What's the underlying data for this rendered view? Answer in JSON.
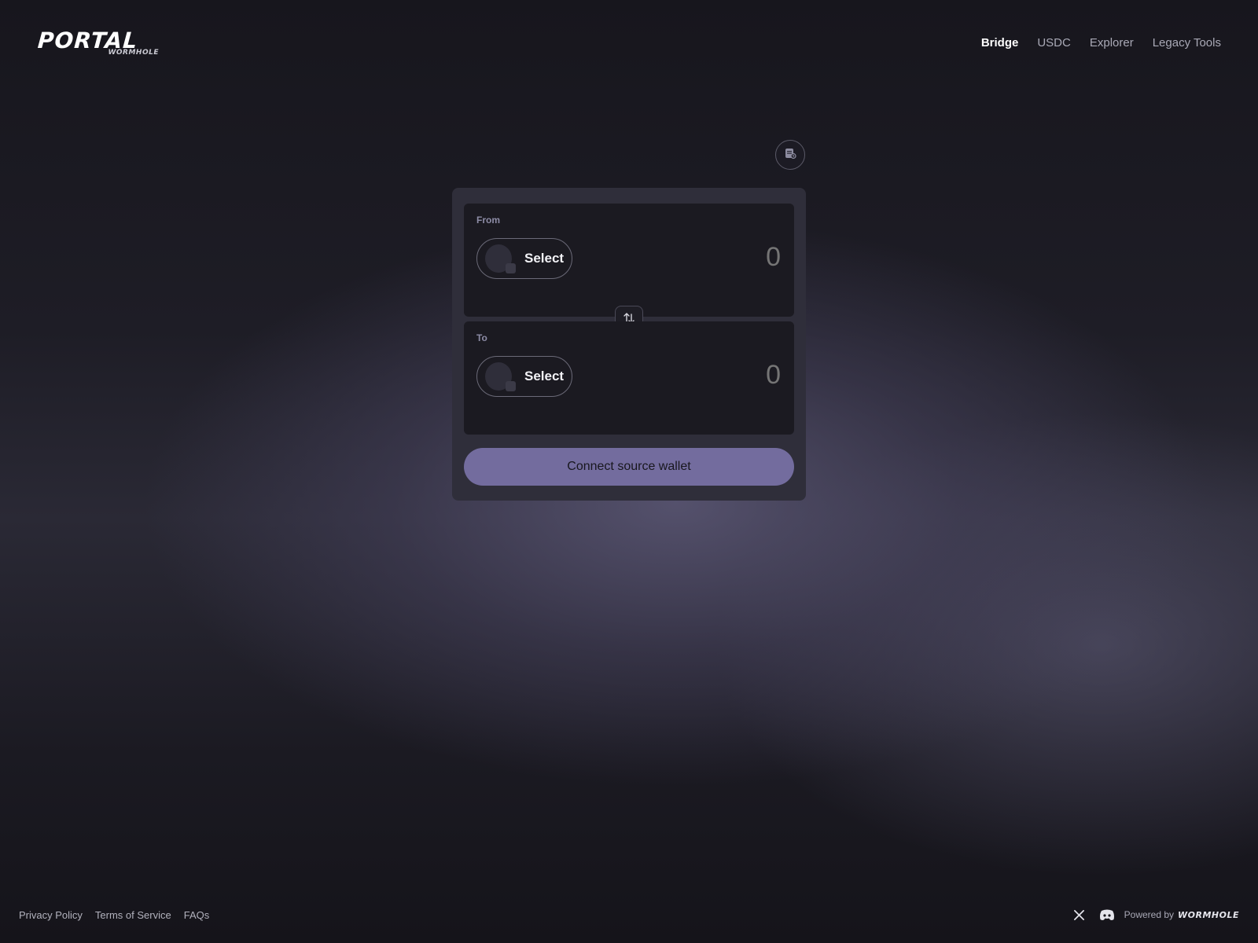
{
  "header": {
    "logo_main": "PORTAL",
    "logo_sub": "WORMHOLE",
    "nav": [
      {
        "label": "Bridge",
        "active": true
      },
      {
        "label": "USDC",
        "active": false
      },
      {
        "label": "Explorer",
        "active": false
      },
      {
        "label": "Legacy Tools",
        "active": false
      }
    ]
  },
  "bridge": {
    "history_icon": "transaction-history-icon",
    "from": {
      "label": "From",
      "select_label": "Select",
      "amount": "0"
    },
    "swap_icon": "swap-arrows-icon",
    "to": {
      "label": "To",
      "select_label": "Select",
      "amount": "0"
    },
    "connect_label": "Connect source wallet"
  },
  "footer": {
    "links": [
      "Privacy Policy",
      "Terms of Service",
      "FAQs"
    ],
    "social": [
      "x-icon",
      "discord-icon"
    ],
    "powered_by": "Powered by",
    "powered_brand": "WORMHOLE"
  },
  "colors": {
    "accent": "#736c9e",
    "card": "#2f2e3a",
    "panel": "#1b1a21",
    "background": "#17161d"
  }
}
